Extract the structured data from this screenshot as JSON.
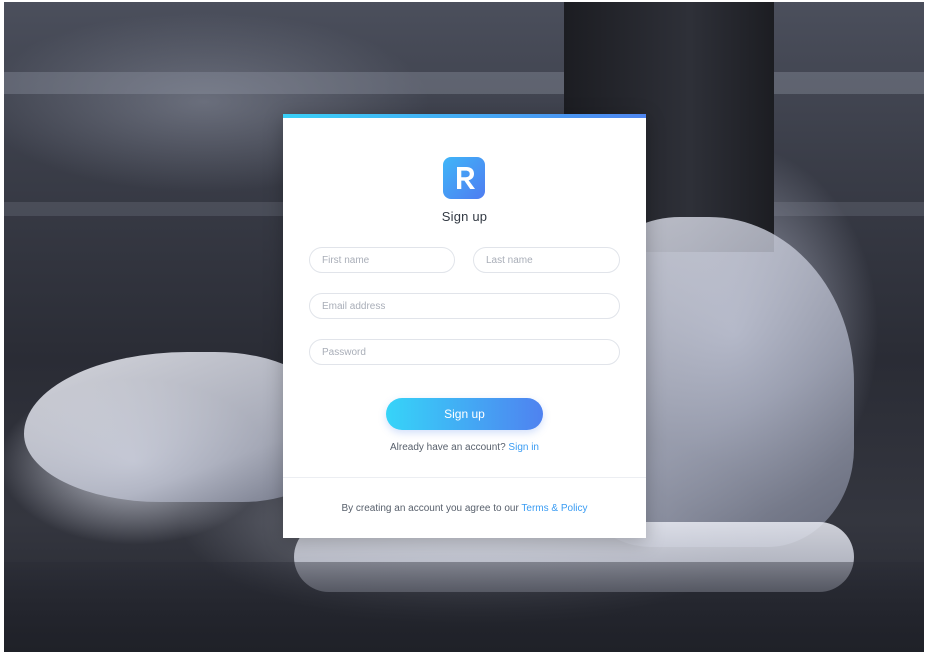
{
  "header": {
    "logo_icon": "r-logo-icon",
    "title": "Sign up"
  },
  "form": {
    "first_name": {
      "placeholder": "First name",
      "value": ""
    },
    "last_name": {
      "placeholder": "Last name",
      "value": ""
    },
    "email": {
      "placeholder": "Email address",
      "value": ""
    },
    "password": {
      "placeholder": "Password",
      "value": ""
    },
    "submit_label": "Sign up"
  },
  "signin": {
    "prompt": "Already have an account?",
    "link_label": "Sign in"
  },
  "footer": {
    "text": "By creating an account you agree to our",
    "link_label": "Terms & Policy"
  },
  "colors": {
    "accent_start": "#36d4f8",
    "accent_end": "#4f82f0",
    "link": "#3a9cf3"
  }
}
